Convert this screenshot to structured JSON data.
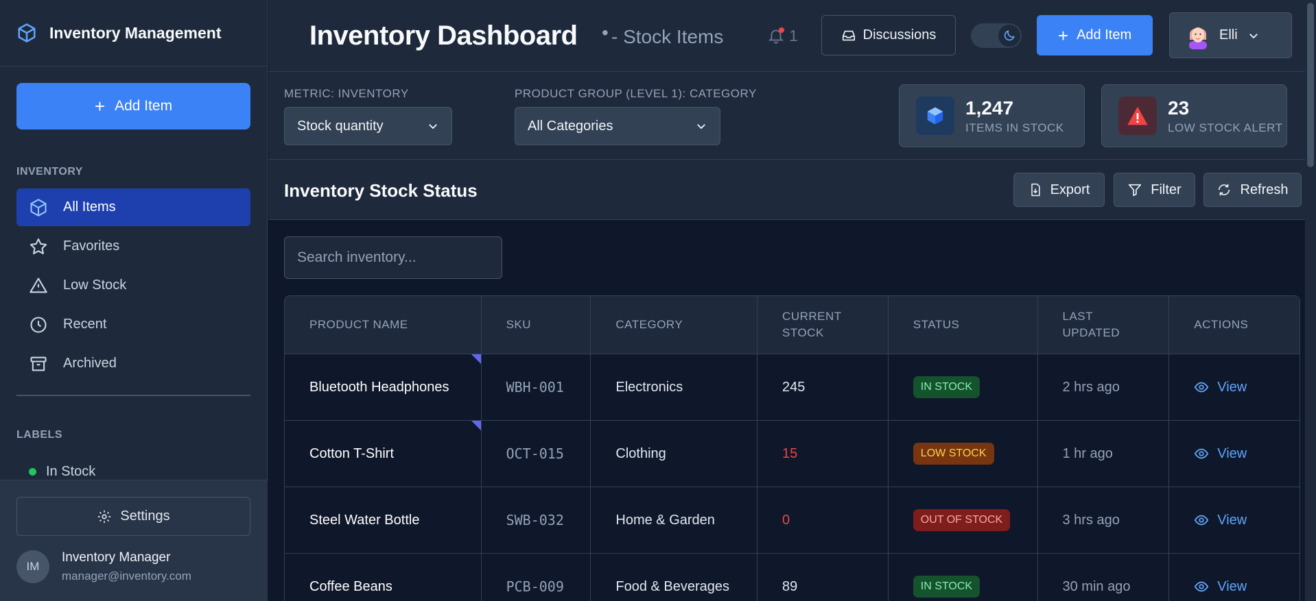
{
  "app": {
    "title": "Inventory Management",
    "accent": "#3b82f6"
  },
  "sidebar": {
    "add_label": "Add Item",
    "inventory_section": "INVENTORY",
    "items": [
      {
        "label": "All Items",
        "icon": "box-icon"
      },
      {
        "label": "Favorites",
        "icon": "star-icon"
      },
      {
        "label": "Low Stock",
        "icon": "warning-icon"
      },
      {
        "label": "Recent",
        "icon": "clock-icon"
      },
      {
        "label": "Archived",
        "icon": "archive-icon"
      }
    ],
    "labels_section": "LABELS",
    "labels": [
      {
        "label": "In Stock",
        "color": "#22c55e"
      }
    ],
    "settings_label": "Settings",
    "user": {
      "initials": "IM",
      "name": "Inventory Manager",
      "email": "manager@inventory.com"
    }
  },
  "header": {
    "title": "Inventory Dashboard",
    "subtitle": "- Stock Items",
    "notification_count": "1",
    "discussions_label": "Discussions",
    "add_label": "Add Item",
    "user_name": "Elli"
  },
  "toolbar": {
    "metric_label": "METRIC: INVENTORY",
    "metric_value": "Stock quantity",
    "group_label": "PRODUCT GROUP (LEVEL 1): CATEGORY",
    "group_value": "All Categories",
    "stats": [
      {
        "value": "1,247",
        "label": "ITEMS IN STOCK",
        "color": "#60a5fa"
      },
      {
        "value": "23",
        "label": "LOW STOCK ALERT",
        "color": "#ef4444"
      }
    ]
  },
  "panel": {
    "title": "Inventory Stock Status",
    "export_label": "Export",
    "filter_label": "Filter",
    "refresh_label": "Refresh",
    "search_placeholder": "Search inventory..."
  },
  "table": {
    "columns": [
      "PRODUCT NAME",
      "SKU",
      "CATEGORY",
      "CURRENT STOCK",
      "STATUS",
      "LAST UPDATED",
      "ACTIONS"
    ],
    "rows": [
      {
        "name": "Bluetooth Headphones",
        "sku": "WBH-001",
        "category": "Electronics",
        "stock": "245",
        "status": "IN STOCK",
        "updated": "2 hrs ago",
        "action": "View"
      },
      {
        "name": "Cotton T-Shirt",
        "sku": "OCT-015",
        "category": "Clothing",
        "stock": "15",
        "status": "LOW STOCK",
        "updated": "1 hr ago",
        "action": "View"
      },
      {
        "name": "Steel Water Bottle",
        "sku": "SWB-032",
        "category": "Home & Garden",
        "stock": "0",
        "status": "OUT OF STOCK",
        "updated": "3 hrs ago",
        "action": "View"
      },
      {
        "name": "Coffee Beans",
        "sku": "PCB-009",
        "category": "Food & Beverages",
        "stock": "89",
        "status": "IN STOCK",
        "updated": "30 min ago",
        "action": "View"
      }
    ]
  }
}
